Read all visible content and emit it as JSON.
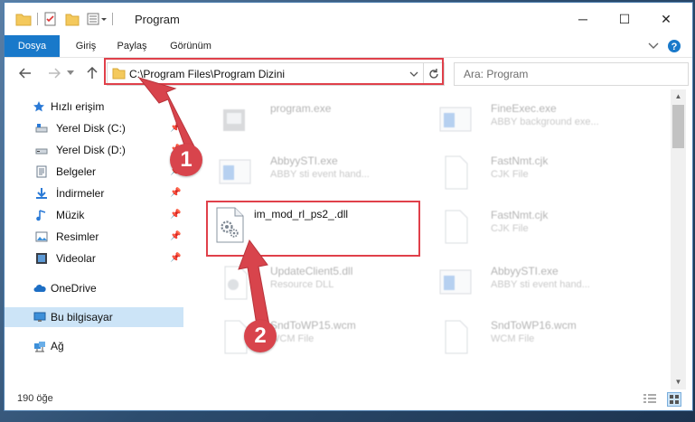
{
  "window": {
    "title": "Program",
    "minimize_glyph": "─",
    "maximize_glyph": "☐",
    "close_glyph": "✕"
  },
  "ribbon": {
    "tabs": [
      {
        "label": "Dosya"
      },
      {
        "label": "Giriş"
      },
      {
        "label": "Paylaş"
      },
      {
        "label": "Görünüm"
      }
    ]
  },
  "address": {
    "path": "C:\\Program Files\\Program Dizini",
    "search_placeholder": "Ara: Program"
  },
  "sidebar": {
    "items": [
      {
        "label": "Hızlı erişim",
        "icon": "star-icon"
      },
      {
        "label": "Yerel Disk (C:)",
        "icon": "drive-icon"
      },
      {
        "label": "Yerel Disk (D:)",
        "icon": "drive-icon"
      },
      {
        "label": "Belgeler",
        "icon": "documents-icon"
      },
      {
        "label": "İndirmeler",
        "icon": "download-icon"
      },
      {
        "label": "Müzik",
        "icon": "music-icon"
      },
      {
        "label": "Resimler",
        "icon": "pictures-icon"
      },
      {
        "label": "Videolar",
        "icon": "videos-icon"
      },
      {
        "label": "OneDrive",
        "icon": "cloud-icon"
      },
      {
        "label": "Bu bilgisayar",
        "icon": "computer-icon"
      },
      {
        "label": "Ağ",
        "icon": "network-icon"
      }
    ]
  },
  "files": [
    {
      "name": "program.exe",
      "desc": ""
    },
    {
      "name": "FineExec.exe",
      "desc": "ABBY background exe..."
    },
    {
      "name": "AbbyySTI.exe",
      "desc": "ABBY sti event hand..."
    },
    {
      "name": "FastNmt.cjk",
      "desc": "CJK File"
    },
    {
      "name": "FastNmt.cjk",
      "desc": "CJK File"
    },
    {
      "name": "UpdateClient5.dll",
      "desc": "Resource DLL"
    },
    {
      "name": "AbbyySTI.exe",
      "desc": "ABBY sti event hand..."
    },
    {
      "name": "SndToWP15.wcm",
      "desc": "WCM File"
    },
    {
      "name": "SndToWP16.wcm",
      "desc": "WCM File"
    }
  ],
  "focused_file": {
    "name": "im_mod_rl_ps2_.dll"
  },
  "status": {
    "count": "190 öğe"
  },
  "annotations": {
    "step1": "1",
    "step2": "2",
    "color": "#d8444c"
  }
}
